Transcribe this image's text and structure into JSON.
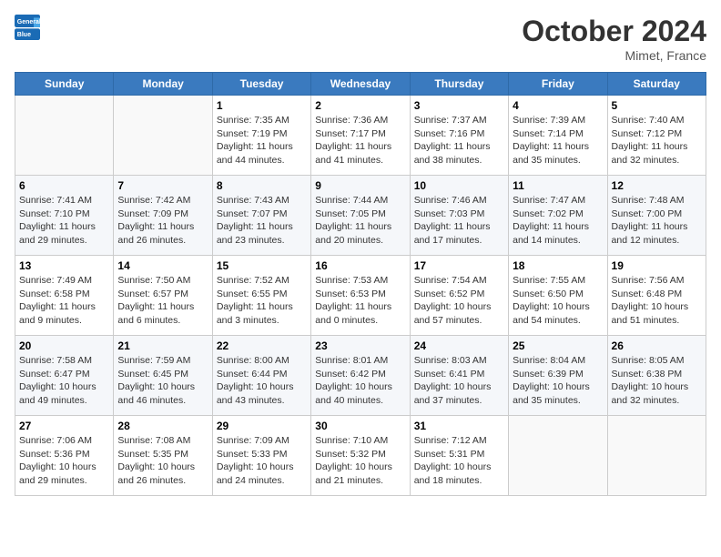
{
  "header": {
    "logo_text_general": "General",
    "logo_text_blue": "Blue",
    "month": "October 2024",
    "location": "Mimet, France"
  },
  "days_of_week": [
    "Sunday",
    "Monday",
    "Tuesday",
    "Wednesday",
    "Thursday",
    "Friday",
    "Saturday"
  ],
  "weeks": [
    [
      {
        "day": "",
        "content": ""
      },
      {
        "day": "",
        "content": ""
      },
      {
        "day": "1",
        "content": "Sunrise: 7:35 AM\nSunset: 7:19 PM\nDaylight: 11 hours and 44 minutes."
      },
      {
        "day": "2",
        "content": "Sunrise: 7:36 AM\nSunset: 7:17 PM\nDaylight: 11 hours and 41 minutes."
      },
      {
        "day": "3",
        "content": "Sunrise: 7:37 AM\nSunset: 7:16 PM\nDaylight: 11 hours and 38 minutes."
      },
      {
        "day": "4",
        "content": "Sunrise: 7:39 AM\nSunset: 7:14 PM\nDaylight: 11 hours and 35 minutes."
      },
      {
        "day": "5",
        "content": "Sunrise: 7:40 AM\nSunset: 7:12 PM\nDaylight: 11 hours and 32 minutes."
      }
    ],
    [
      {
        "day": "6",
        "content": "Sunrise: 7:41 AM\nSunset: 7:10 PM\nDaylight: 11 hours and 29 minutes."
      },
      {
        "day": "7",
        "content": "Sunrise: 7:42 AM\nSunset: 7:09 PM\nDaylight: 11 hours and 26 minutes."
      },
      {
        "day": "8",
        "content": "Sunrise: 7:43 AM\nSunset: 7:07 PM\nDaylight: 11 hours and 23 minutes."
      },
      {
        "day": "9",
        "content": "Sunrise: 7:44 AM\nSunset: 7:05 PM\nDaylight: 11 hours and 20 minutes."
      },
      {
        "day": "10",
        "content": "Sunrise: 7:46 AM\nSunset: 7:03 PM\nDaylight: 11 hours and 17 minutes."
      },
      {
        "day": "11",
        "content": "Sunrise: 7:47 AM\nSunset: 7:02 PM\nDaylight: 11 hours and 14 minutes."
      },
      {
        "day": "12",
        "content": "Sunrise: 7:48 AM\nSunset: 7:00 PM\nDaylight: 11 hours and 12 minutes."
      }
    ],
    [
      {
        "day": "13",
        "content": "Sunrise: 7:49 AM\nSunset: 6:58 PM\nDaylight: 11 hours and 9 minutes."
      },
      {
        "day": "14",
        "content": "Sunrise: 7:50 AM\nSunset: 6:57 PM\nDaylight: 11 hours and 6 minutes."
      },
      {
        "day": "15",
        "content": "Sunrise: 7:52 AM\nSunset: 6:55 PM\nDaylight: 11 hours and 3 minutes."
      },
      {
        "day": "16",
        "content": "Sunrise: 7:53 AM\nSunset: 6:53 PM\nDaylight: 11 hours and 0 minutes."
      },
      {
        "day": "17",
        "content": "Sunrise: 7:54 AM\nSunset: 6:52 PM\nDaylight: 10 hours and 57 minutes."
      },
      {
        "day": "18",
        "content": "Sunrise: 7:55 AM\nSunset: 6:50 PM\nDaylight: 10 hours and 54 minutes."
      },
      {
        "day": "19",
        "content": "Sunrise: 7:56 AM\nSunset: 6:48 PM\nDaylight: 10 hours and 51 minutes."
      }
    ],
    [
      {
        "day": "20",
        "content": "Sunrise: 7:58 AM\nSunset: 6:47 PM\nDaylight: 10 hours and 49 minutes."
      },
      {
        "day": "21",
        "content": "Sunrise: 7:59 AM\nSunset: 6:45 PM\nDaylight: 10 hours and 46 minutes."
      },
      {
        "day": "22",
        "content": "Sunrise: 8:00 AM\nSunset: 6:44 PM\nDaylight: 10 hours and 43 minutes."
      },
      {
        "day": "23",
        "content": "Sunrise: 8:01 AM\nSunset: 6:42 PM\nDaylight: 10 hours and 40 minutes."
      },
      {
        "day": "24",
        "content": "Sunrise: 8:03 AM\nSunset: 6:41 PM\nDaylight: 10 hours and 37 minutes."
      },
      {
        "day": "25",
        "content": "Sunrise: 8:04 AM\nSunset: 6:39 PM\nDaylight: 10 hours and 35 minutes."
      },
      {
        "day": "26",
        "content": "Sunrise: 8:05 AM\nSunset: 6:38 PM\nDaylight: 10 hours and 32 minutes."
      }
    ],
    [
      {
        "day": "27",
        "content": "Sunrise: 7:06 AM\nSunset: 5:36 PM\nDaylight: 10 hours and 29 minutes."
      },
      {
        "day": "28",
        "content": "Sunrise: 7:08 AM\nSunset: 5:35 PM\nDaylight: 10 hours and 26 minutes."
      },
      {
        "day": "29",
        "content": "Sunrise: 7:09 AM\nSunset: 5:33 PM\nDaylight: 10 hours and 24 minutes."
      },
      {
        "day": "30",
        "content": "Sunrise: 7:10 AM\nSunset: 5:32 PM\nDaylight: 10 hours and 21 minutes."
      },
      {
        "day": "31",
        "content": "Sunrise: 7:12 AM\nSunset: 5:31 PM\nDaylight: 10 hours and 18 minutes."
      },
      {
        "day": "",
        "content": ""
      },
      {
        "day": "",
        "content": ""
      }
    ]
  ]
}
